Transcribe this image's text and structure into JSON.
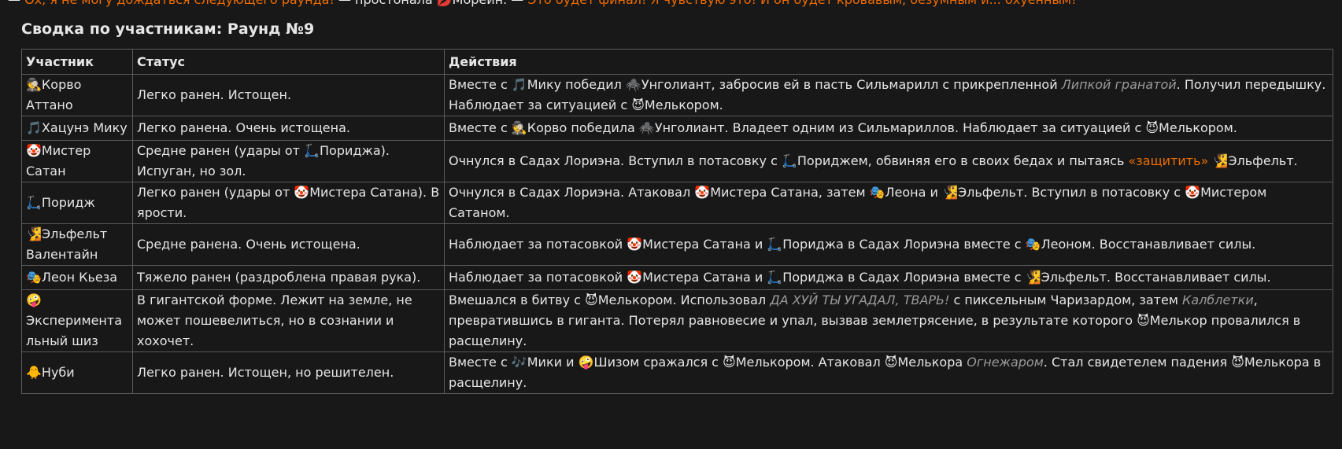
{
  "top_line": {
    "prefix": "—",
    "quote_a": "Ох, я не могу дождаться следующего раунда!",
    "middle": "— простонала 💋Морейн. —",
    "quote_b": "Это будет финал! Я чувствую это! И он будет кровавым, безумным и... охуенным!"
  },
  "section_title": "Сводка по участникам: Раунд №9",
  "table": {
    "headers": [
      "Участник",
      "Статус",
      "Действия"
    ],
    "rows": [
      {
        "name": "🕵️Корво Аттано",
        "status": "Легко ранен. Истощен.",
        "actions": [
          {
            "t": "Вместе с 🎵Мику победил 🕷️Унголиант, забросив ей в пасть Сильмарилл с прикрепленной "
          },
          {
            "t": "Липкой гранатой",
            "s": "ital"
          },
          {
            "t": ". Получил передышку. Наблюдает за ситуацией с 😈Мелькором."
          }
        ]
      },
      {
        "name": "🎵Хацунэ Мику",
        "status": "Легко ранена. Очень истощена.",
        "actions": [
          {
            "t": "Вместе с 🕵️Корво победила 🕷️Унголиант. Владеет одним из Сильмариллов. Наблюдает за ситуацией с 😈Мелькором."
          }
        ]
      },
      {
        "name": "🤡Мистер Сатан",
        "status": "Средне ранен (удары от 🛴Пориджа). Испуган, но зол.",
        "actions": [
          {
            "t": "Очнулся в Садах Лориэна. Вступил в потасовку с 🛴Пориджем, обвиняя его в своих бедах и пытаясь "
          },
          {
            "t": "«защитить»",
            "s": "orange"
          },
          {
            "t": " 🧏Эльфельт."
          }
        ]
      },
      {
        "name": "🛴Поридж",
        "status": "Легко ранен (удары от 🤡Мистера Сатана). В ярости.",
        "actions": [
          {
            "t": "Очнулся в Садах Лориэна. Атаковал 🤡Мистера Сатана, затем 🎭Леона и 🧏Эльфельт. Вступил в потасовку с 🤡Мистером Сатаном."
          }
        ]
      },
      {
        "name": "🧏Эльфельт Валентайн",
        "status": "Средне ранена. Очень истощена.",
        "actions": [
          {
            "t": "Наблюдает за потасовкой 🤡Мистера Сатана и 🛴Пориджа в Садах Лориэна вместе с 🎭Леоном. Восстанавливает силы."
          }
        ]
      },
      {
        "name": "🎭Леон Кьеза",
        "status": "Тяжело ранен (раздроблена правая рука).",
        "actions": [
          {
            "t": "Наблюдает за потасовкой 🤡Мистера Сатана и 🛴Пориджа в Садах Лориэна вместе с 🧏Эльфельт. Восстанавливает силы."
          }
        ]
      },
      {
        "name": "🤪Экспериментальный шиз",
        "status": "В гигантской форме. Лежит на земле, не может пошевелиться, но в сознании и хохочет.",
        "actions": [
          {
            "t": "Вмешался в битву с 😈Мелькором. Использовал "
          },
          {
            "t": "ДА ХУЙ ТЫ УГАДАЛ, ТВАРЬ!",
            "s": "ital"
          },
          {
            "t": " с пиксельным Чаризардом, затем "
          },
          {
            "t": "Калблетки",
            "s": "ital"
          },
          {
            "t": ", превратившись в гиганта. Потерял равновесие и упал, вызвав землетрясение, в результате которого 😈Мелькор провалился в расщелину."
          }
        ]
      },
      {
        "name": "🐥Нуби",
        "status": "Легко ранен. Истощен, но решителен.",
        "actions": [
          {
            "t": "Вместе с 🎶Мики и 🤪Шизом сражался с 😈Мелькором. Атаковал 😈Мелькора "
          },
          {
            "t": "Огнежаром",
            "s": "ital"
          },
          {
            "t": ". Стал свидетелем падения 😈Мелькора в расщелину."
          }
        ]
      }
    ]
  }
}
